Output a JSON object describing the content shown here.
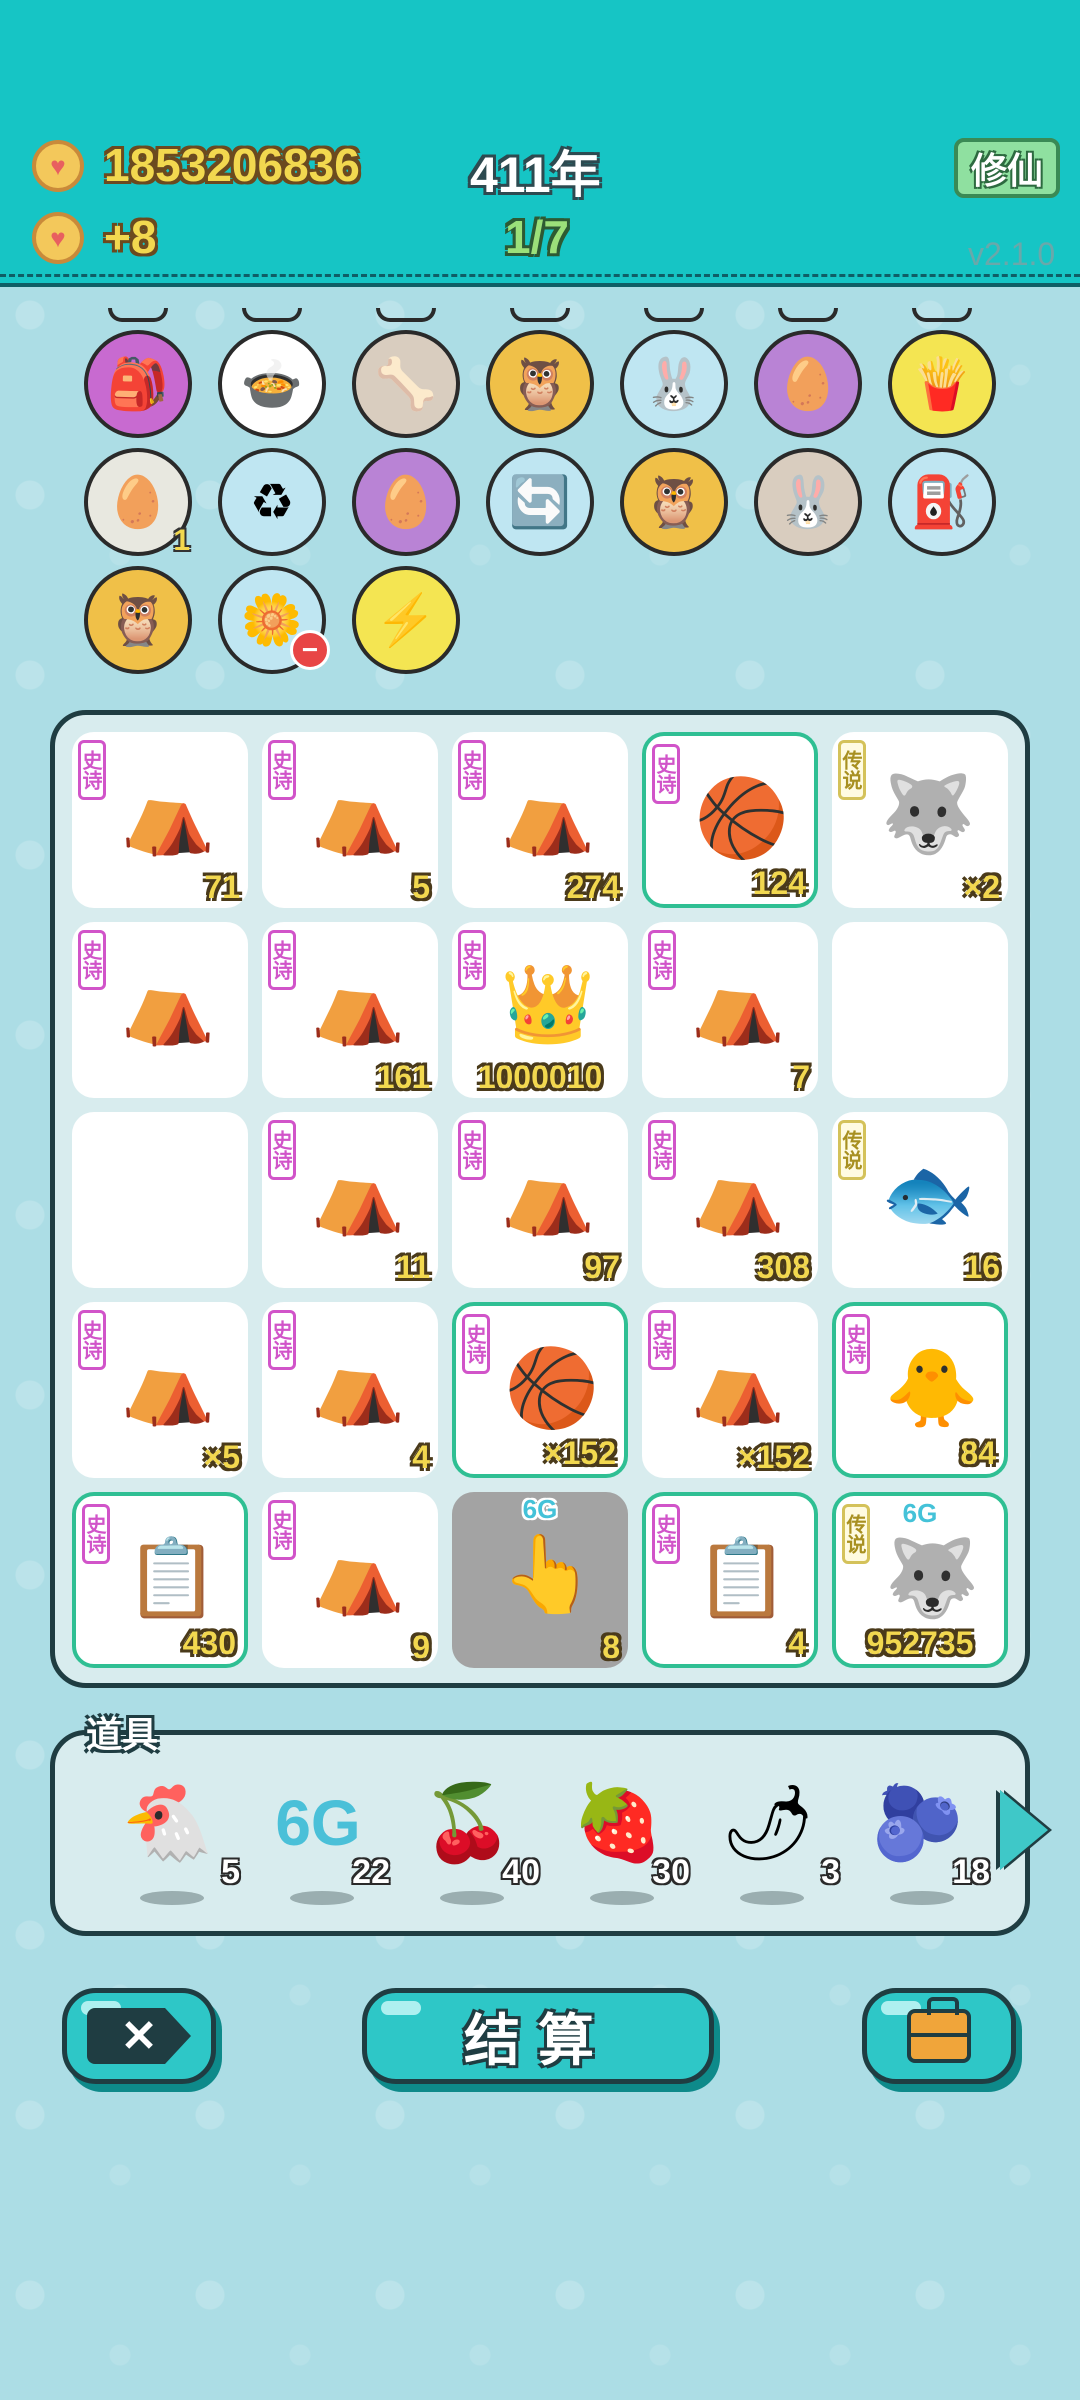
{
  "header": {
    "coins": "1853206836",
    "income": "+8",
    "year": "411年",
    "progress": "1/7",
    "mode_button": "修仙",
    "version": "v2.1.0",
    "colors": {
      "bar": "#16c5c5",
      "coin_text": "#f2d84f"
    }
  },
  "modifiers": [
    {
      "icon": "pink-bag-icon",
      "glyph": "🎒",
      "bg": "#c86ad0"
    },
    {
      "icon": "pot-duck-icon",
      "glyph": "🍲",
      "bg": "#ffffff"
    },
    {
      "icon": "dog-bowl-icon",
      "glyph": "🦴",
      "bg": "#d9cdbf"
    },
    {
      "icon": "owls-icon",
      "glyph": "🦉",
      "bg": "#f0c048"
    },
    {
      "icon": "white-rabbit-icon",
      "glyph": "🐰",
      "bg": "#bfe6f2"
    },
    {
      "icon": "egg-icon",
      "glyph": "🥚",
      "bg": "#b983d5"
    },
    {
      "icon": "fries-icon",
      "glyph": "🍟",
      "bg": "#f4e552"
    },
    {
      "icon": "egg-carton-icon",
      "glyph": "🥚",
      "bg": "#e8e8e0",
      "count": "1"
    },
    {
      "icon": "recycle-bag-icon",
      "glyph": "♻",
      "bg": "#bfe6f2"
    },
    {
      "icon": "egg-icon",
      "glyph": "🥚",
      "bg": "#b983d5"
    },
    {
      "icon": "recycle-arrows-icon",
      "glyph": "🔄",
      "bg": "#bfe6f2"
    },
    {
      "icon": "owls-icon",
      "glyph": "🦉",
      "bg": "#f0c048"
    },
    {
      "icon": "white-rabbit-icon",
      "glyph": "🐰",
      "bg": "#d9cdbf"
    },
    {
      "icon": "air-pump-icon",
      "glyph": "⛽",
      "bg": "#bfe6f2"
    },
    {
      "icon": "owls-icon",
      "glyph": "🦉",
      "bg": "#f0c048"
    },
    {
      "icon": "flower-pot-icon",
      "glyph": "🌼",
      "bg": "#bfe6f2",
      "minus": true
    },
    {
      "icon": "lightning-icon",
      "glyph": "⚡",
      "bg": "#f4e552"
    }
  ],
  "grid": [
    {
      "rarity": "史诗",
      "icon": "rabbit-tent-icon",
      "glyph": "⛺",
      "count": "71"
    },
    {
      "rarity": "史诗",
      "icon": "rabbit-tent-icon",
      "glyph": "⛺",
      "count": "5"
    },
    {
      "rarity": "史诗",
      "icon": "rabbit-tent-icon",
      "glyph": "⛺",
      "count": "274"
    },
    {
      "rarity": "史诗",
      "icon": "copy-basketball-icon",
      "glyph": "🏀",
      "count": "124",
      "green": true
    },
    {
      "rarity": "传说",
      "icon": "husky-king-icon",
      "glyph": "🐺",
      "count": "×2",
      "legend": true
    },
    {
      "rarity": "史诗",
      "icon": "rabbit-tent-icon",
      "glyph": "⛺",
      "count": ""
    },
    {
      "rarity": "史诗",
      "icon": "rabbit-tent-icon",
      "glyph": "⛺",
      "count": "161"
    },
    {
      "rarity": "史诗",
      "icon": "crowned-rabbit-tent-icon",
      "glyph": "👑",
      "count": "1000010",
      "wide": true
    },
    {
      "rarity": "史诗",
      "icon": "rabbit-tent-icon",
      "glyph": "⛺",
      "count": "7"
    },
    {
      "empty": true
    },
    {
      "empty": true
    },
    {
      "rarity": "史诗",
      "icon": "rabbit-tent-icon",
      "glyph": "⛺",
      "count": "11"
    },
    {
      "rarity": "史诗",
      "icon": "rabbit-tent-icon",
      "glyph": "⛺",
      "count": "97"
    },
    {
      "rarity": "史诗",
      "icon": "rabbit-tent-icon",
      "glyph": "⛺",
      "count": "308"
    },
    {
      "rarity": "传说",
      "icon": "koi-fish-icon",
      "glyph": "🐟",
      "count": "16",
      "legend": true
    },
    {
      "rarity": "史诗",
      "icon": "rabbit-tent-icon",
      "glyph": "⛺",
      "count": "×5"
    },
    {
      "rarity": "史诗",
      "icon": "rabbit-tent-icon",
      "glyph": "⛺",
      "count": "4"
    },
    {
      "rarity": "史诗",
      "icon": "copy-basketball-icon",
      "glyph": "🏀",
      "count": "×152",
      "green": true
    },
    {
      "rarity": "史诗",
      "icon": "rabbit-tent-icon",
      "glyph": "⛺",
      "count": "×152"
    },
    {
      "rarity": "史诗",
      "icon": "silver-hair-chick-icon",
      "glyph": "🐥",
      "count": "84",
      "green": true
    },
    {
      "rarity": "史诗",
      "icon": "ctrl-c-ctrl-v-icon",
      "glyph": "📋",
      "count": "430",
      "green": true
    },
    {
      "rarity": "史诗",
      "icon": "rabbit-tent-icon",
      "glyph": "⛺",
      "count": "9"
    },
    {
      "icon": "pointing-hand-icon",
      "glyph": "👆",
      "count": "8",
      "gray": true,
      "top_label": "6G"
    },
    {
      "rarity": "史诗",
      "icon": "ctrl-c-ctrl-v-icon",
      "glyph": "📋",
      "count": "4",
      "green": true
    },
    {
      "rarity": "传说",
      "icon": "husky-king-icon",
      "glyph": "🐺",
      "count": "952735",
      "legend": true,
      "green": true,
      "top_label": "6G",
      "wide": true
    }
  ],
  "props": {
    "label": "道具",
    "items": [
      {
        "icon": "white-chicken-icon",
        "glyph": "🐔",
        "count": "5"
      },
      {
        "icon": "6g-icon",
        "glyph": "6G",
        "count": "22"
      },
      {
        "icon": "lychee-icon",
        "glyph": "🍒",
        "count": "40"
      },
      {
        "icon": "strawberry-icon",
        "glyph": "🍓",
        "count": "30"
      },
      {
        "icon": "chili-icon",
        "glyph": "🌶",
        "count": "3"
      },
      {
        "icon": "blueberry-icon",
        "glyph": "🫐",
        "count": "18"
      }
    ]
  },
  "buttons": {
    "settle": "结算"
  }
}
